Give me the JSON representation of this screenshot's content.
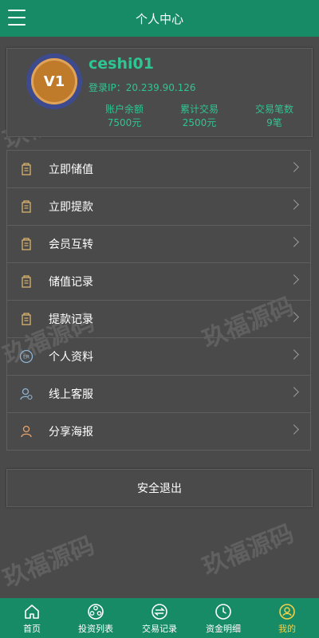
{
  "header": {
    "title": "个人中心"
  },
  "profile": {
    "level": "V1",
    "username": "ceshi01",
    "login_ip": "登录IP：20.239.90.126",
    "stats": [
      {
        "label": "账户余额",
        "value": "7500元"
      },
      {
        "label": "累计交易",
        "value": "2500元"
      },
      {
        "label": "交易笔数",
        "value": "9笔"
      }
    ]
  },
  "menu": {
    "items": [
      {
        "label": "立即储值",
        "icon": "receipt-icon"
      },
      {
        "label": "立即提款",
        "icon": "receipt-icon"
      },
      {
        "label": "会员互转",
        "icon": "receipt-icon"
      },
      {
        "label": "储值记录",
        "icon": "receipt-icon"
      },
      {
        "label": "提款记录",
        "icon": "receipt-icon"
      },
      {
        "label": "个人资料",
        "icon": "profile-badge-icon"
      },
      {
        "label": "线上客服",
        "icon": "customer-service-icon"
      },
      {
        "label": "分享海报",
        "icon": "share-person-icon"
      }
    ]
  },
  "logout_label": "安全退出",
  "tabbar": {
    "items": [
      {
        "label": "首页",
        "icon": "home-icon"
      },
      {
        "label": "投资列表",
        "icon": "grid-icon"
      },
      {
        "label": "交易记录",
        "icon": "exchange-icon"
      },
      {
        "label": "资金明细",
        "icon": "clock-icon"
      },
      {
        "label": "我的",
        "icon": "user-icon"
      }
    ],
    "active_color": "#f2d14b"
  },
  "watermark": "玖福源码",
  "colors": {
    "header": "#178a66",
    "accent": "#2fc592",
    "background": "#4a4a4a"
  }
}
